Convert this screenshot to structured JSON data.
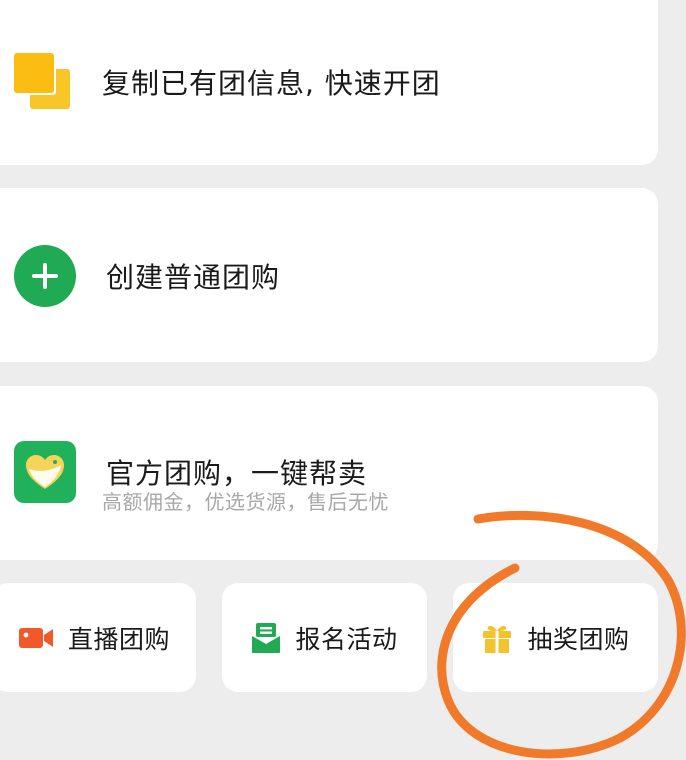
{
  "colors": {
    "background": "#ededed",
    "card": "#ffffff",
    "copy_icon_back": "#f8c626",
    "copy_icon_front": "#fbbd12",
    "plus_icon": "#1faa53",
    "official_icon": "#20b15a",
    "official_icon_inner": "#f7d35a",
    "live_icon": "#f05a2b",
    "signup_icon": "#1faa53",
    "lottery_icon": "#f3c22d",
    "annotation_stroke": "#f07a2a"
  },
  "cards": {
    "copy": {
      "icon": "copy-icon",
      "title": "复制已有团信息, 快速开团"
    },
    "create": {
      "icon": "plus-circle-icon",
      "title": "创建普通团购"
    },
    "official": {
      "icon": "official-group-buy-icon",
      "title": "官方团购，一键帮卖",
      "subtitle": "高额佣金，优选货源，售后无忧"
    }
  },
  "quick_actions": [
    {
      "icon": "video-camera-icon",
      "label": "直播团购"
    },
    {
      "icon": "signup-envelope-icon",
      "label": "报名活动"
    },
    {
      "icon": "gift-icon",
      "label": "抽奖团购"
    }
  ]
}
